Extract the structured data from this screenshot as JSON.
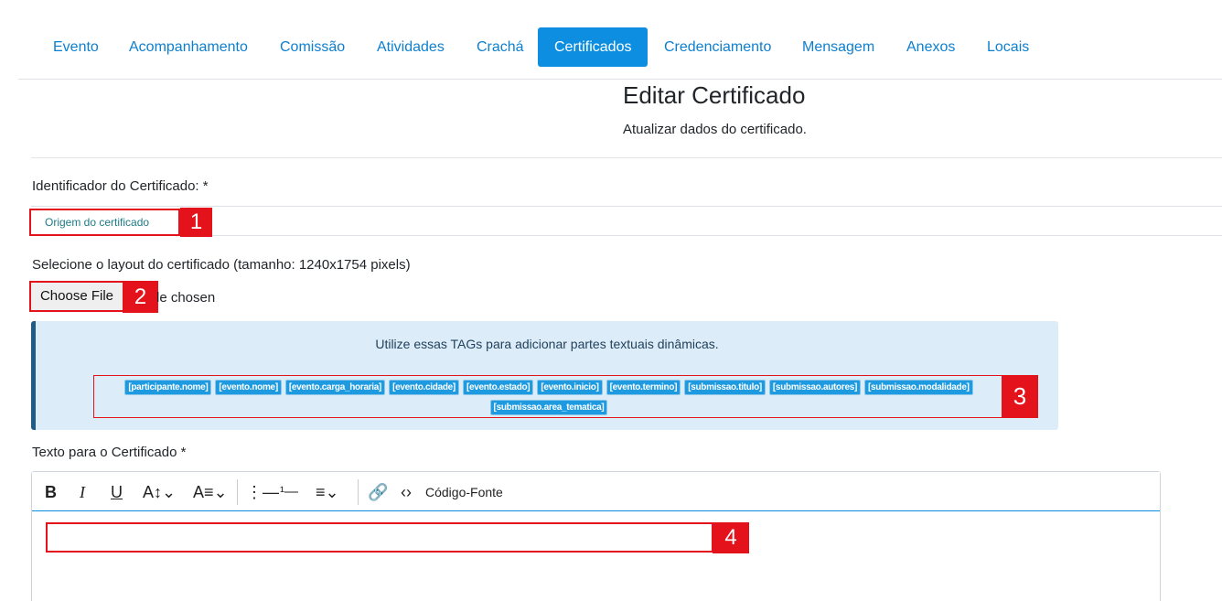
{
  "nav": {
    "tabs": [
      {
        "label": "Evento",
        "active": false
      },
      {
        "label": "Acompanhamento",
        "active": false
      },
      {
        "label": "Comissão",
        "active": false
      },
      {
        "label": "Atividades",
        "active": false
      },
      {
        "label": "Crachá",
        "active": false
      },
      {
        "label": "Certificados",
        "active": true
      },
      {
        "label": "Credenciamento",
        "active": false
      },
      {
        "label": "Mensagem",
        "active": false
      },
      {
        "label": "Anexos",
        "active": false
      },
      {
        "label": "Locais",
        "active": false
      }
    ]
  },
  "header": {
    "title": "Editar Certificado",
    "subtitle": "Atualizar dados do certificado."
  },
  "form": {
    "identifier_label": "Identificador do Certificado: *",
    "identifier_value": "Origem do certificado",
    "layout_label": "Selecione o layout do certificado (tamanho: 1240x1754 pixels)",
    "file_button": "Choose File",
    "file_status": "le chosen",
    "text_label": "Texto para o Certificado *"
  },
  "alert": {
    "text": "Utilize essas TAGs para adicionar partes textuais dinâmicas.",
    "tags_row1": [
      "[participante.nome]",
      "[evento.nome]",
      "[evento.carga_horaria]",
      "[evento.cidade]",
      "[evento.estado]",
      "[evento.inicio]",
      "[evento.termino]",
      "[submissao.titulo]",
      "[submissao.autores]",
      "[submissao.modalidade]"
    ],
    "tags_row2": [
      "[submissao.area_tematica]"
    ]
  },
  "editor": {
    "source_label": "Código-Fonte",
    "content": ""
  },
  "markers": [
    "1",
    "2",
    "3",
    "4"
  ],
  "colors": {
    "accent": "#0d8ee0",
    "marker": "#e4121b",
    "alert_bg": "#dcecf8"
  }
}
